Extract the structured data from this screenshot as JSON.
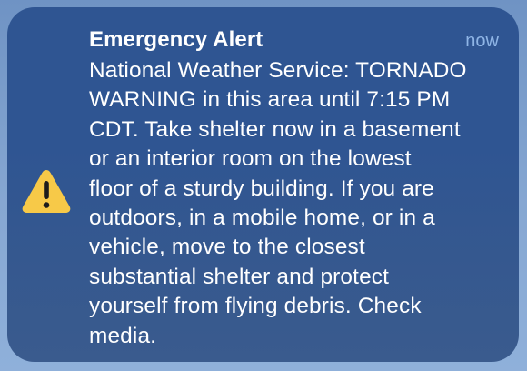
{
  "notification": {
    "title": "Emergency Alert",
    "time": "now",
    "icon": "warning-icon",
    "message": "National Weather Service: TORNADO\nWARNING in this area until 7:15 PM\nCDT. Take shelter now in a basement\nor an interior room on the lowest\nfloor of a sturdy building. If you are\noutdoors, in a mobile home, or in a\nvehicle, move to the closest\nsubstantial shelter and protect\nyourself from flying debris. Check\nmedia."
  },
  "colors": {
    "card_background": "#2f5592",
    "warning_yellow": "#f7c948",
    "time_text": "#8fb5e6",
    "text": "#ffffff"
  }
}
